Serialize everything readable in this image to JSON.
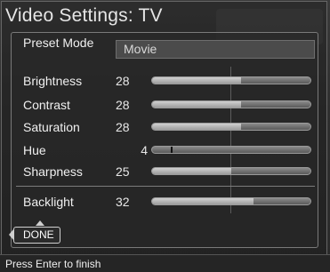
{
  "title": "Video Settings: TV",
  "preset": {
    "label": "Preset Mode",
    "value": "Movie"
  },
  "settings": [
    {
      "name": "Brightness",
      "value": "28",
      "level": 0.56
    },
    {
      "name": "Contrast",
      "value": "28",
      "level": 0.56
    },
    {
      "name": "Saturation",
      "value": "28",
      "level": 0.56
    },
    {
      "name": "Hue",
      "value": "4",
      "level": 0.12
    },
    {
      "name": "Sharpness",
      "value": "25",
      "level": 0.5
    }
  ],
  "backlight": {
    "name": "Backlight",
    "value": "32",
    "level": 0.64
  },
  "done_label": "DONE",
  "status": "Press Enter to finish"
}
